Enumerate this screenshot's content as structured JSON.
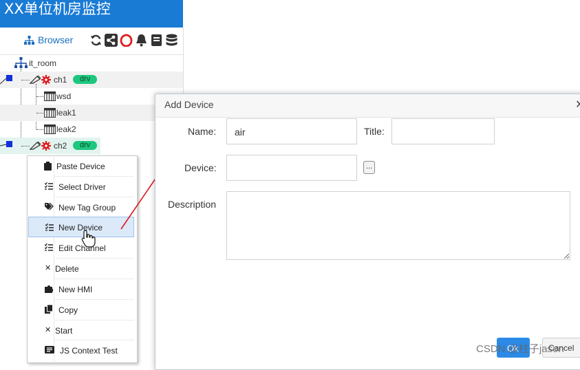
{
  "app": {
    "title": "XX单位机房监控"
  },
  "browser": {
    "label": "Browser"
  },
  "toolbar": {
    "icons": [
      "refresh-icon",
      "share-icon",
      "ring-icon",
      "bell-icon",
      "book-icon",
      "database-icon"
    ]
  },
  "tree": {
    "root": {
      "label": "it_room"
    },
    "nodes": [
      {
        "label": "ch1",
        "badge": "drv"
      },
      {
        "label": "wsd"
      },
      {
        "label": "leak1"
      },
      {
        "label": "leak2"
      },
      {
        "label": "ch2",
        "badge": "drv"
      }
    ]
  },
  "context_menu": {
    "items": [
      {
        "label": "Paste Device",
        "icon": "clipboard-icon"
      },
      {
        "label": "Select Driver",
        "icon": "list-icon"
      },
      {
        "label": "New Tag Group",
        "icon": "tags-icon"
      },
      {
        "label": "New Device",
        "icon": "list-icon",
        "highlighted": true
      },
      {
        "label": "Edit Channel",
        "icon": "list-icon"
      },
      {
        "label": "Delete",
        "icon": "times-icon"
      },
      {
        "label": "New HMI",
        "icon": "puzzle-icon"
      },
      {
        "label": "Copy",
        "icon": "copy-icon"
      },
      {
        "label": "Start",
        "icon": "times-icon"
      },
      {
        "label": "JS Context Test",
        "icon": "terminal-icon"
      }
    ]
  },
  "dialog": {
    "title": "Add Device",
    "name_label": "Name:",
    "name_value": "air",
    "title_label": "Title:",
    "title_value": "",
    "device_label": "Device:",
    "device_value": "",
    "browse_label": "...",
    "description_label": "Description",
    "description_value": "",
    "ok_label": "Ok",
    "cancel_label": "Cancel"
  },
  "watermark": {
    "text": "CSDN @柱子jason"
  },
  "colors": {
    "title_bar": "#1a7bd5",
    "badge": "#1ec77e",
    "ok_button": "#2a8ae6",
    "arrow": "#e0191c"
  }
}
